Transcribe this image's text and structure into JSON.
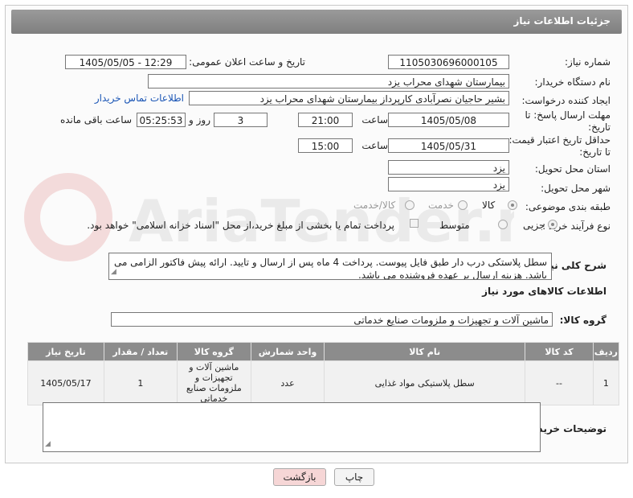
{
  "header": {
    "title": "جزئیات اطلاعات نیاز"
  },
  "need_number": {
    "label": "شماره نیاز:",
    "value": "1105030696000105"
  },
  "announce": {
    "label": "تاریخ و ساعت اعلان عمومی:",
    "value": "1405/05/05 - 12:29"
  },
  "buyer_org": {
    "label": "نام دستگاه خریدار:",
    "value": "بیمارستان شهدای محراب یزد"
  },
  "requester": {
    "label": "ایجاد کننده درخواست:",
    "value": "بشیر حاجیان نصرآبادی کارپرداز بیمارستان شهدای محراب یزد",
    "contact_link": "اطلاعات تماس خریدار"
  },
  "deadline": {
    "label_line1": "مهلت ارسال پاسخ: تا",
    "label_line2": "تاریخ:",
    "date": "1405/05/08",
    "time_label": "ساعت",
    "time": "21:00",
    "days": "3",
    "days_label": "روز و",
    "remaining": "05:25:53",
    "remaining_label": "ساعت باقی مانده"
  },
  "price_validity": {
    "label_line1": "حداقل تاریخ اعتبار قیمت:",
    "label_line2": "تا تاریخ:",
    "date": "1405/05/31",
    "time_label": "ساعت",
    "time": "15:00"
  },
  "province": {
    "label": "استان محل تحویل:",
    "value": "یزد"
  },
  "city": {
    "label": "شهر محل تحویل:",
    "value": "یزد"
  },
  "category": {
    "label": "طبقه بندی موضوعی:",
    "options": [
      "کالا",
      "خدمت",
      "کالا/خدمت"
    ],
    "selected": "کالا"
  },
  "process": {
    "label": "نوع فرآیند خرید :",
    "options": [
      "جزیی",
      "متوسط"
    ],
    "payment_note": "پرداخت تمام یا بخشی از مبلغ خرید،از محل \"اسناد خزانه اسلامی\" خواهد بود."
  },
  "description": {
    "label": "شرح کلی نیاز:",
    "text": "سطل پلاستکی درب دار طبق فایل پیوست. پرداخت 4 ماه پس از ارسال و تایید. ارائه پیش فاکتور الزامی می باشد. هزینه ارسال بر عهده فروشنده می باشد."
  },
  "goods_info": {
    "title": "اطلاعات کالاهای مورد نیاز"
  },
  "goods_group": {
    "label": "گروه کالا:",
    "value": "ماشین آلات و تجهیزات و ملزومات صنایع خدماتی"
  },
  "table": {
    "headers": [
      "ردیف",
      "کد کالا",
      "نام کالا",
      "واحد شمارش",
      "گروه کالا",
      "تعداد / مقدار",
      "تاریخ نیاز"
    ],
    "rows": [
      [
        "1",
        "--",
        "سطل پلاستیکی مواد غذایی",
        "عدد",
        "ماشین آلات و تجهیزات و ملزومات صنایع خدماتی",
        "1",
        "1405/05/17"
      ]
    ]
  },
  "buyer_notes": {
    "label": "توضیحات خریدار:",
    "text": ""
  },
  "buttons": {
    "print": "چاپ",
    "back": "بازگشت"
  },
  "watermark": {
    "text": "AriaTender.net"
  },
  "colors": {
    "header_bg": "#8e8e8e",
    "back_button_bg": "#f6d6d6",
    "link": "#1a55b5"
  }
}
